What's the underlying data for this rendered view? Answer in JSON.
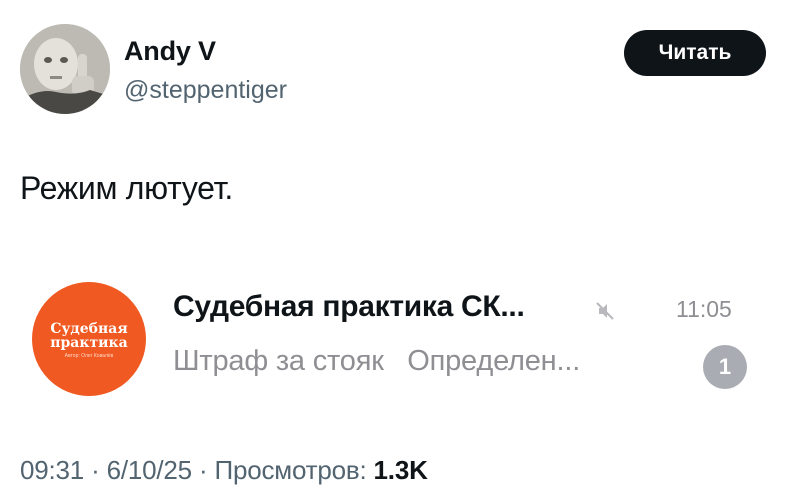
{
  "author": {
    "name": "Andy V",
    "handle": "@steppentiger",
    "avatar_icon": "user-avatar"
  },
  "follow_button": {
    "label": "Читать"
  },
  "tweet": {
    "text": "Режим лютует."
  },
  "chat": {
    "avatar_line1": "Судебная",
    "avatar_line2": "практика",
    "avatar_sub": "Автор: Олег Ковалёв",
    "title": "Судебная практика СК...",
    "muted_icon": "mute-icon",
    "time": "11:05",
    "preview": "Штраф за стояк   Определен...",
    "unread_count": "1",
    "accent_color": "#f05a22"
  },
  "meta": {
    "time": "09:31",
    "separator1": " · ",
    "date": "6/10/25",
    "separator2": " · ",
    "views_label": "Просмотров: ",
    "views_count": "1.3K"
  }
}
